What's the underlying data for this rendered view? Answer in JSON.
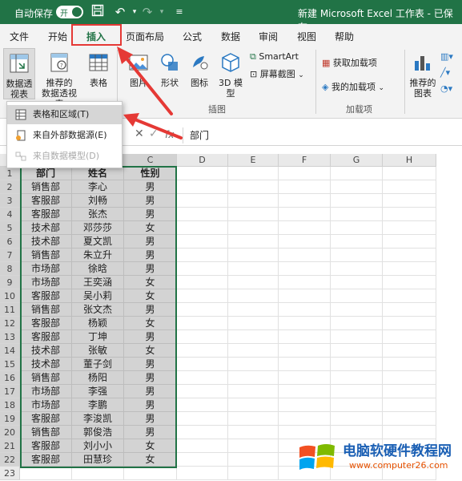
{
  "titlebar": {
    "autosave_label": "自动保存",
    "toggle_label": "开",
    "doc_title": "新建 Microsoft Excel 工作表 - 已保存"
  },
  "tabs": [
    "文件",
    "开始",
    "插入",
    "页面布局",
    "公式",
    "数据",
    "审阅",
    "视图",
    "帮助"
  ],
  "active_tab": "插入",
  "ribbon": {
    "pivot_table": "数据透\n视表",
    "recommended_pivot": "推荐的\n数据透视表",
    "table": "表格",
    "pictures": "图片",
    "shapes": "形状",
    "icons": "图标",
    "models_3d": "3D 模\n型",
    "smartart": "SmartArt",
    "screenshot": "屏幕截图",
    "illustrations_label": "插图",
    "get_addins": "获取加载项",
    "my_addins": "我的加载项",
    "addins_label": "加载项",
    "recommended_charts": "推荐的\n图表"
  },
  "dropdown": {
    "items": [
      {
        "label": "表格和区域(T)",
        "state": "highlighted"
      },
      {
        "label": "来自外部数据源(E)",
        "state": "normal"
      },
      {
        "label": "来自数据模型(D)",
        "state": "disabled"
      }
    ]
  },
  "formula_bar": {
    "fx": "fx",
    "value": "部门"
  },
  "columns": [
    "A",
    "B",
    "C",
    "D",
    "E",
    "F",
    "G",
    "H"
  ],
  "table": {
    "headers": [
      "部门",
      "姓名",
      "性别"
    ],
    "rows": [
      [
        "销售部",
        "李心",
        "男"
      ],
      [
        "客服部",
        "刘畅",
        "男"
      ],
      [
        "客服部",
        "张杰",
        "男"
      ],
      [
        "技术部",
        "邓莎莎",
        "女"
      ],
      [
        "技术部",
        "夏文凯",
        "男"
      ],
      [
        "销售部",
        "朱立升",
        "男"
      ],
      [
        "市场部",
        "徐晗",
        "男"
      ],
      [
        "市场部",
        "王奕涵",
        "女"
      ],
      [
        "客服部",
        "吴小莉",
        "女"
      ],
      [
        "销售部",
        "张文杰",
        "男"
      ],
      [
        "客服部",
        "杨颖",
        "女"
      ],
      [
        "客服部",
        "丁坤",
        "男"
      ],
      [
        "技术部",
        "张敏",
        "女"
      ],
      [
        "技术部",
        "董子剑",
        "男"
      ],
      [
        "销售部",
        "杨阳",
        "男"
      ],
      [
        "市场部",
        "李强",
        "男"
      ],
      [
        "市场部",
        "李鹏",
        "男"
      ],
      [
        "客服部",
        "李浚凯",
        "男"
      ],
      [
        "销售部",
        "郭俊浩",
        "男"
      ],
      [
        "客服部",
        "刘小小",
        "女"
      ],
      [
        "客服部",
        "田慧珍",
        "女"
      ]
    ]
  },
  "row_numbers": [
    "1",
    "2",
    "3",
    "4",
    "5",
    "6",
    "7",
    "8",
    "9",
    "10",
    "11",
    "12",
    "13",
    "14",
    "15",
    "16",
    "17",
    "18",
    "19",
    "20",
    "21",
    "22",
    "23"
  ],
  "watermark": {
    "title": "电脑软硬件教程网",
    "url": "www.computer26.com"
  },
  "colors": {
    "excel_green": "#217346",
    "annotation_red": "#e53935",
    "selection_gray": "#d3d3d3"
  }
}
